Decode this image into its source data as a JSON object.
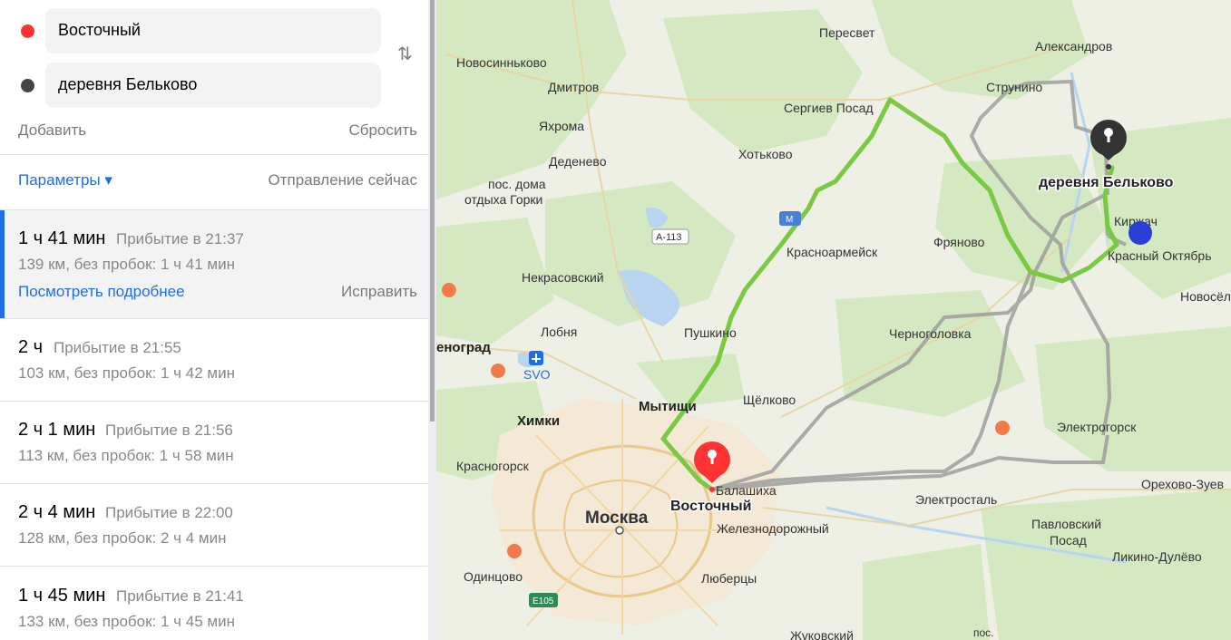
{
  "waypoints": {
    "from": {
      "label": "Восточный",
      "color": "#ff3333"
    },
    "to": {
      "label": "деревня Бельково",
      "color": "#444444"
    }
  },
  "actions": {
    "add": "Добавить",
    "reset": "Сбросить"
  },
  "params": {
    "label": "Параметры ▾",
    "departure": "Отправление сейчас"
  },
  "routes": [
    {
      "time": "1 ч 41 мин",
      "arrival": "Прибытие в 21:37",
      "details": "139 км, без пробок: 1 ч 41 мин",
      "more": "Посмотреть подробнее",
      "fix": "Исправить"
    },
    {
      "time": "2 ч",
      "arrival": "Прибытие в 21:55",
      "details": "103 км, без пробок: 1 ч 42 мин"
    },
    {
      "time": "2 ч 1 мин",
      "arrival": "Прибытие в 21:56",
      "details": "113 км, без пробок: 1 ч 58 мин"
    },
    {
      "time": "2 ч 4 мин",
      "arrival": "Прибытие в 22:00",
      "details": "128 км, без пробок: 2 ч 4 мин"
    },
    {
      "time": "1 ч 45 мин",
      "arrival": "Прибытие в 21:41",
      "details": "133 км, без пробок: 1 ч 45 мин"
    }
  ],
  "map": {
    "places": {
      "pereslavl": "Пересвет",
      "aleksandrov": "Александров",
      "novosinkovo": "Новосинньково",
      "dmitrov": "Дмитров",
      "strunino": "Струнино",
      "sergiev": "Сергиев Посад",
      "yakhroma": "Яхрома",
      "khotkovo": "Хотьково",
      "dedenevo": "Деденево",
      "gorki1": "пос. дома",
      "gorki2": "отдыха Горки",
      "kirzhach": "Киржач",
      "krasnoarmeysk": "Красноармейск",
      "fryanovo": "Фряново",
      "krasny": "Красный Октябрь",
      "nekrasovsky": "Некрасовский",
      "novosel": "Новосёл",
      "lobnya": "Лобня",
      "pushkino": "Пушкино",
      "chernogolovka": "Черноголовка",
      "zelenograd": "еноград",
      "svo": "SVO",
      "mytishchi": "Мытищи",
      "shchelkovo": "Щёлково",
      "khimki": "Химки",
      "elektrogorsk": "Электрогорск",
      "krasnogorsk": "Красногорск",
      "balashikha": "Балашиха",
      "orekhovo": "Орехово-Зуев",
      "elektrostal": "Электросталь",
      "moskva": "Москва",
      "zheleznodorozhny": "Железнодорожный",
      "pavlovsky1": "Павловский",
      "pavlovsky2": "Посад",
      "odintsovo": "Одинцово",
      "lyubertsy": "Люберцы",
      "likino": "Ликино-Дулёво",
      "zhukovsky": "Жуковский",
      "pos": "пос."
    },
    "shields": {
      "a113": "А-113",
      "m": "М",
      "e105": "E105"
    },
    "pins": {
      "start": "Восточный",
      "end": "деревня Бельково"
    },
    "colors": {
      "route_main": "#7ac943",
      "route_alt": "#9a9a9a",
      "pin_start": "#ff3333",
      "pin_end": "#333333",
      "current_location": "#2a3fd6"
    }
  }
}
